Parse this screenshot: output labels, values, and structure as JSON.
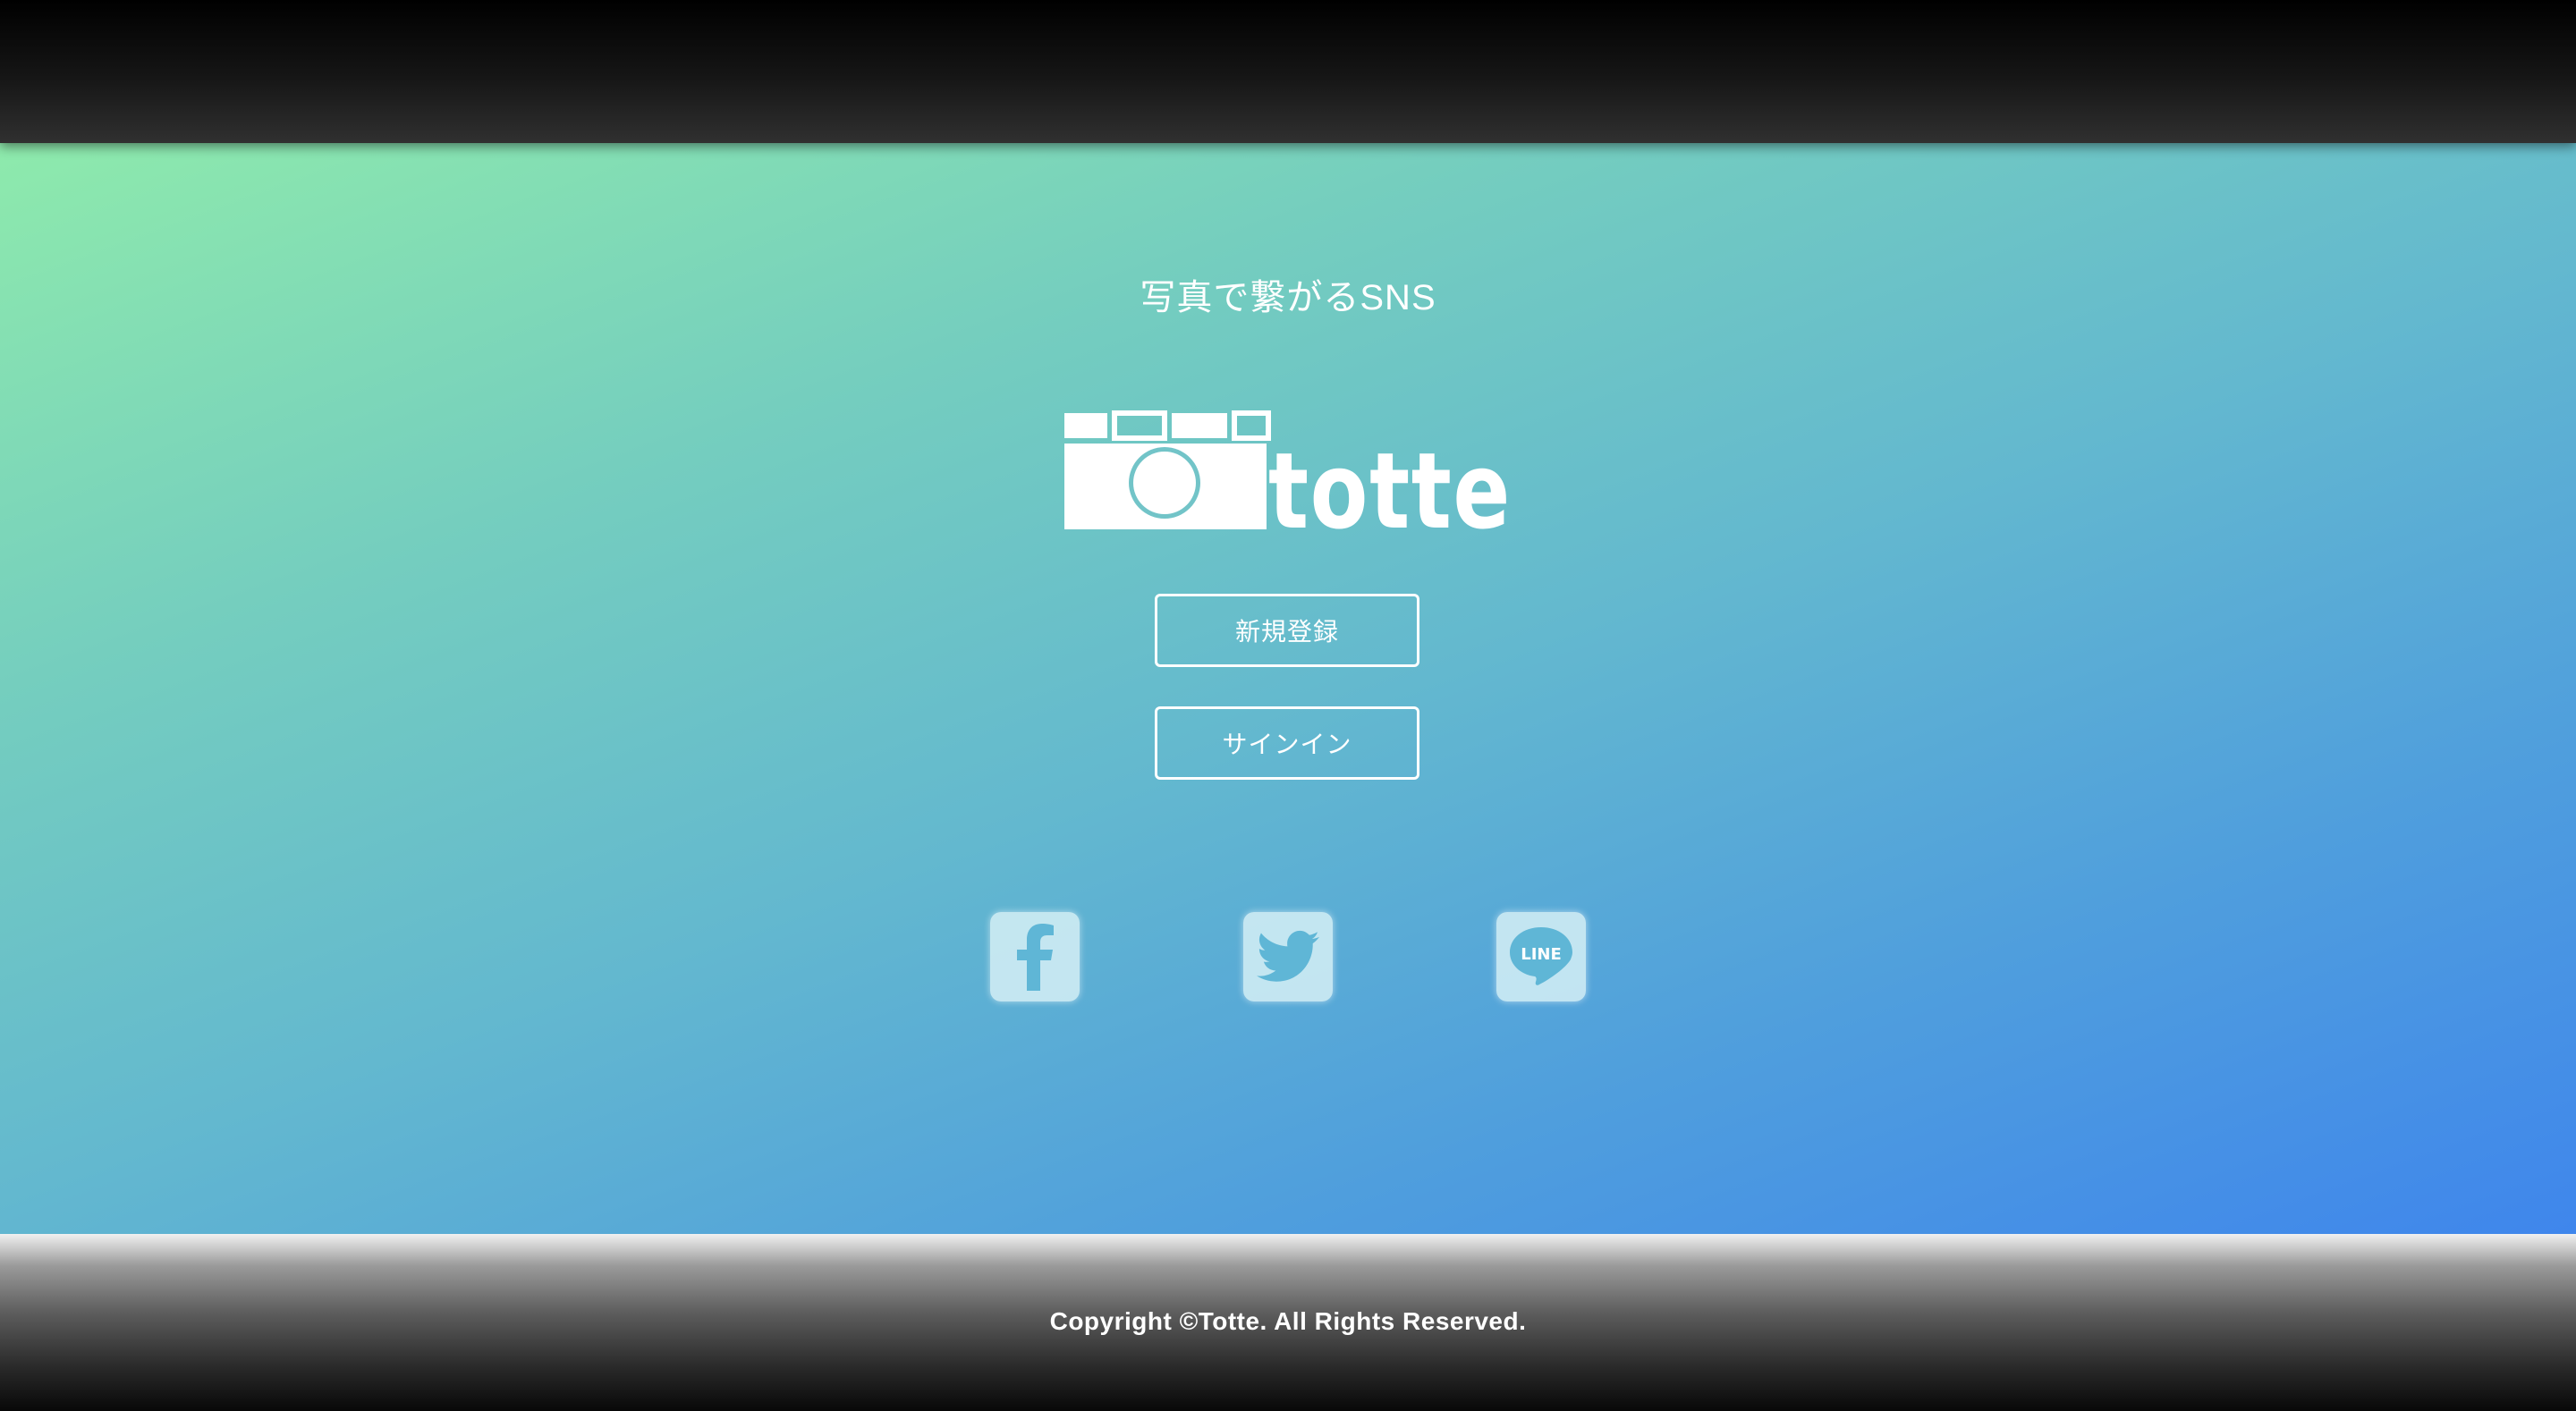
{
  "header": {},
  "hero": {
    "tagline": "写真で繋がるSNS",
    "logo_text": "totte"
  },
  "actions": {
    "register_label": "新規登録",
    "signin_label": "サインイン"
  },
  "social": [
    {
      "icon": "facebook-icon"
    },
    {
      "icon": "twitter-icon"
    },
    {
      "icon": "line-icon",
      "text": "LINE"
    }
  ],
  "footer": {
    "copyright": "Copyright ©Totte. All Rights Reserved."
  },
  "colors": {
    "gradient_start": "#8eeaac",
    "gradient_end": "#3f86ec",
    "social_bg": "#d6f0f6"
  }
}
